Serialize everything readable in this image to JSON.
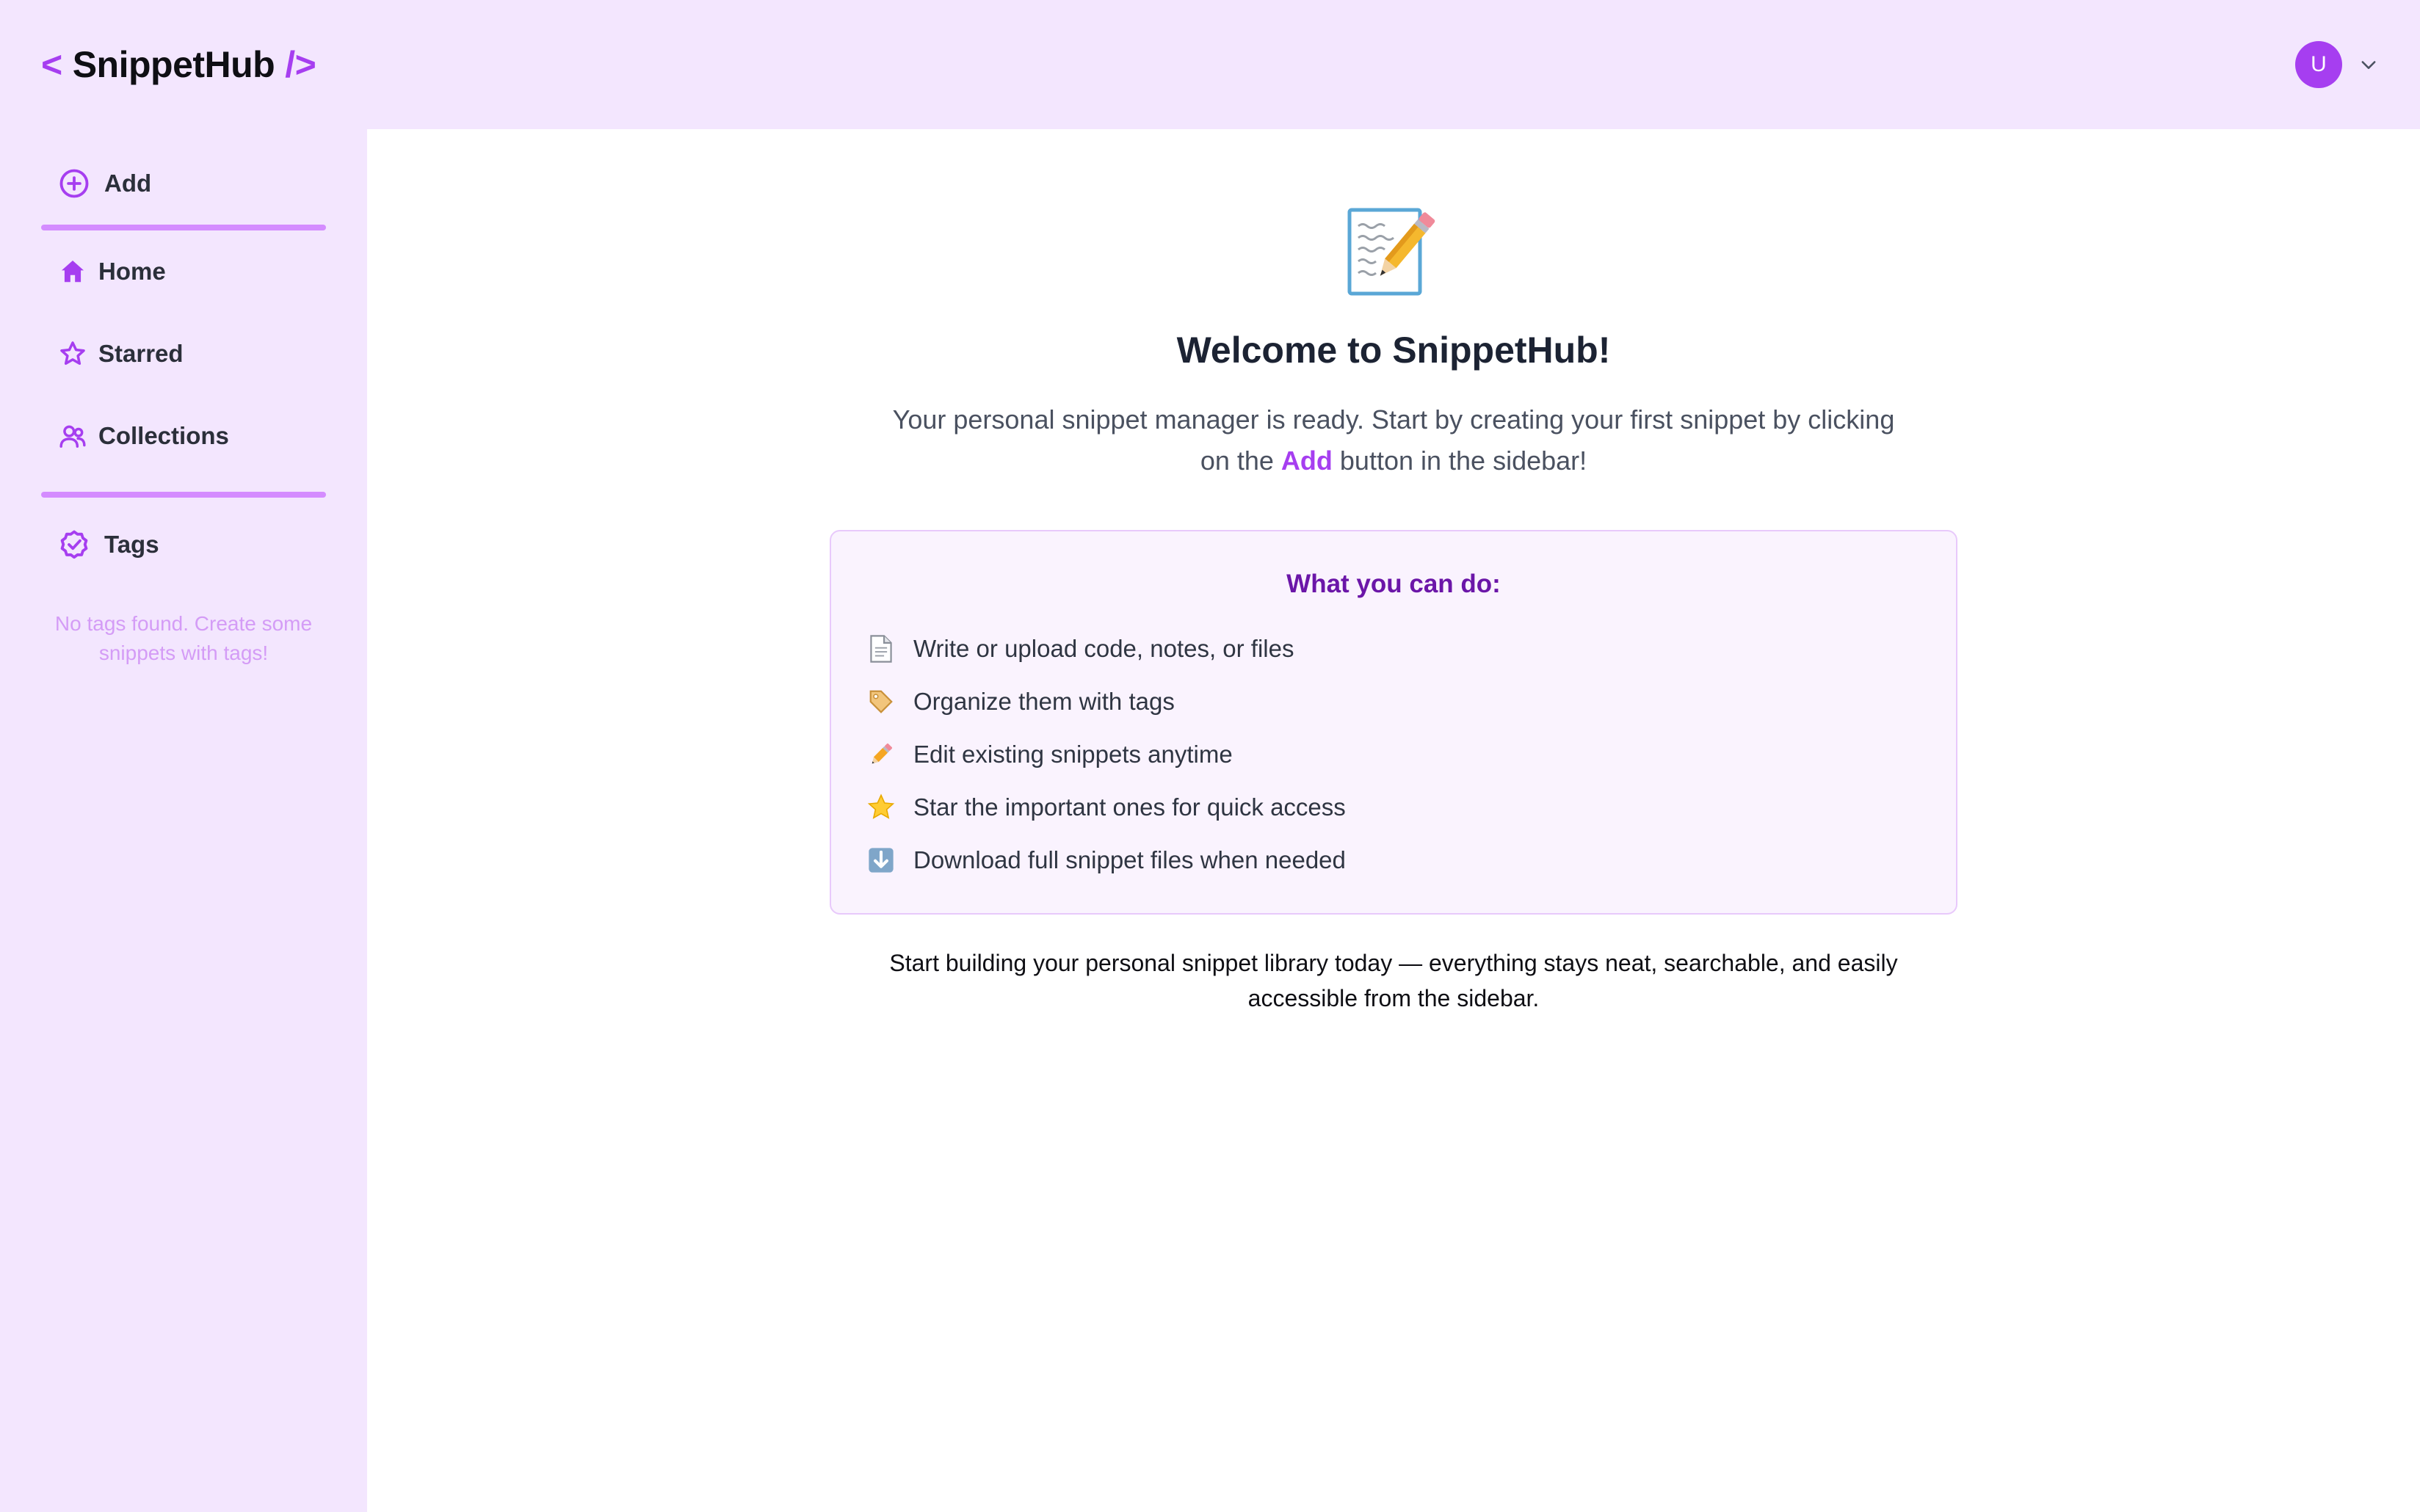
{
  "app": {
    "logo_bracket_left": "<",
    "logo_name": "SnippetHub",
    "logo_bracket_right": "/>"
  },
  "header": {
    "avatar_initial": "U"
  },
  "sidebar": {
    "items": [
      {
        "label": "Add",
        "icon": "plus-circle-icon"
      },
      {
        "label": "Home",
        "icon": "home-icon"
      },
      {
        "label": "Starred",
        "icon": "star-icon"
      },
      {
        "label": "Collections",
        "icon": "users-icon"
      },
      {
        "label": "Tags",
        "icon": "badge-check-icon"
      }
    ],
    "empty_tags_message": "No tags found. Create some snippets with tags!"
  },
  "main": {
    "hero_icon": "memo-pencil-icon",
    "title": "Welcome to SnippetHub!",
    "subtitle_before": "Your personal snippet manager is ready. Start by creating your first snippet by clicking on the ",
    "subtitle_highlight": "Add",
    "subtitle_after": " button in the sidebar!",
    "card": {
      "title": "What you can do:",
      "items": [
        {
          "icon": "page-icon",
          "text": "Write or upload code, notes, or files"
        },
        {
          "icon": "label-tag-icon",
          "text": "Organize them with tags"
        },
        {
          "icon": "pencil-icon",
          "text": "Edit existing snippets anytime"
        },
        {
          "icon": "star-icon",
          "text": "Star the important ones for quick access"
        },
        {
          "icon": "download-arrow-icon",
          "text": "Download full snippet files when needed"
        }
      ]
    },
    "footer_text": "Start building your personal snippet library today — everything stays neat, searchable, and easily accessible from the sidebar."
  },
  "colors": {
    "accent": "#a63ef0",
    "header_bg": "#f3e6fe",
    "sidebar_bg": "#f3e6fe",
    "divider": "#d48cff",
    "card_bg": "#faf3fe",
    "card_border": "#e8c9fb",
    "card_title": "#6b16a8"
  }
}
